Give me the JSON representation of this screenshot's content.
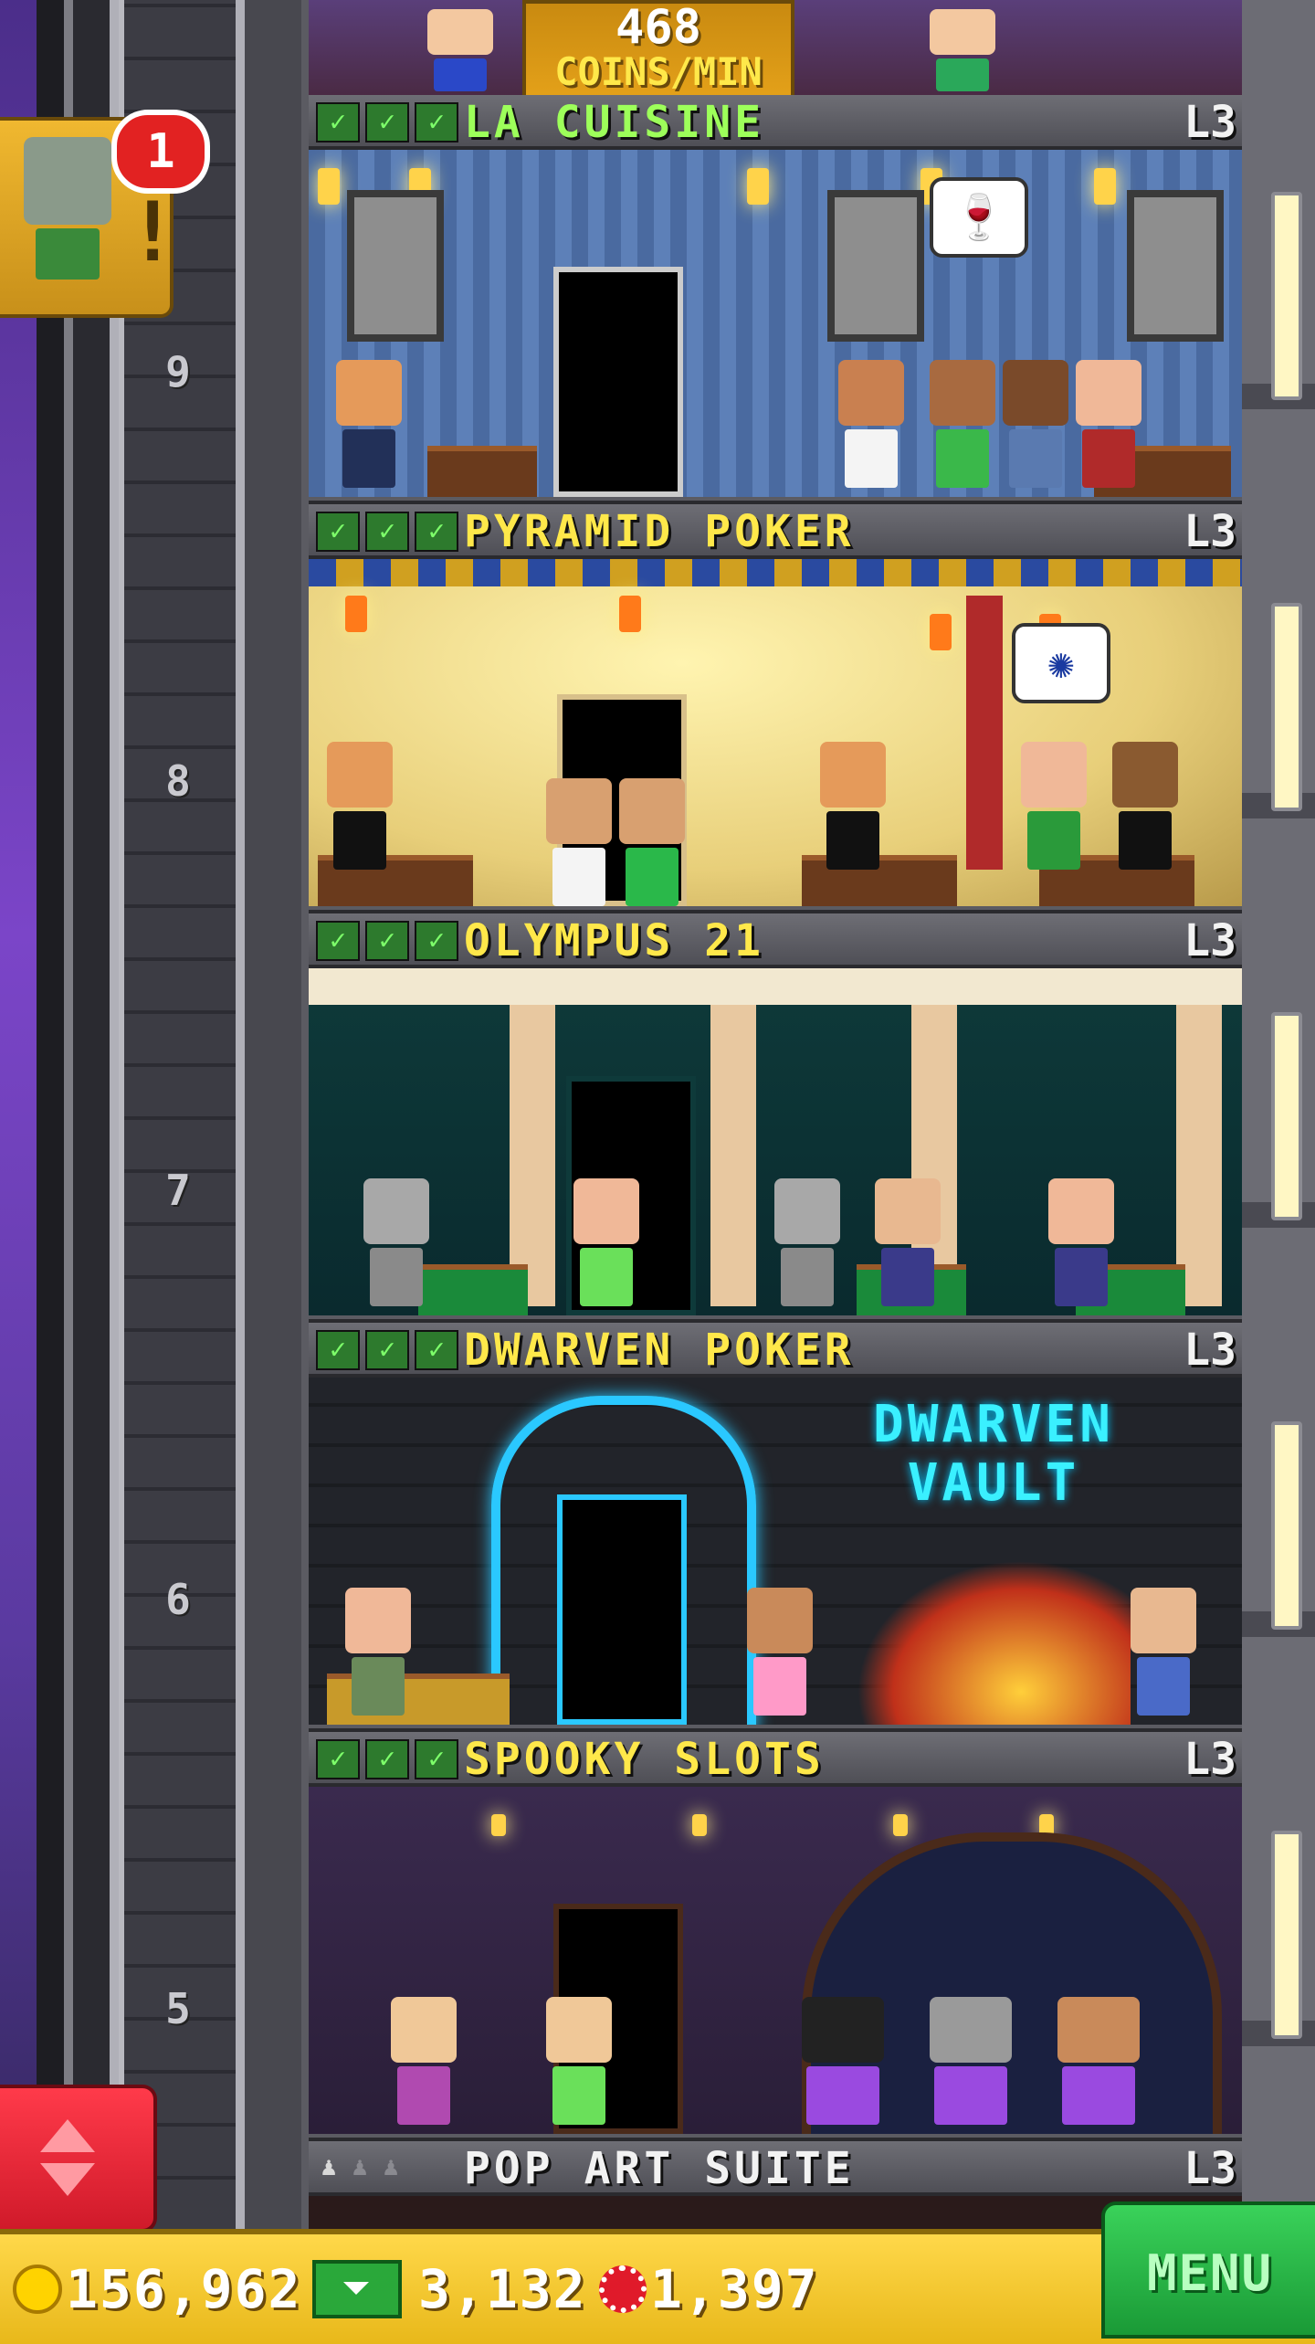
{
  "game": "tower-casino",
  "top_room": {
    "coins_per_min_value": "468",
    "coins_per_min_label": "COINS/MIN"
  },
  "notification": {
    "count": "1",
    "icon": "zombie-visitor-icon",
    "mark": "!"
  },
  "floors": [
    {
      "number": "9",
      "name": "LA CUISINE",
      "name_color": "#9dff5a",
      "level": "L3",
      "stocked": [
        "check",
        "check",
        "check"
      ],
      "theme": "restaurant",
      "bubble": "wine-glass-icon"
    },
    {
      "number": "8",
      "name": "PYRAMID POKER",
      "name_color": "#ffe84a",
      "level": "L3",
      "stocked": [
        "check",
        "check",
        "check"
      ],
      "theme": "egyptian",
      "bubble": "poker-chip-icon"
    },
    {
      "number": "7",
      "name": "OLYMPUS 21",
      "name_color": "#ffe84a",
      "level": "L3",
      "stocked": [
        "check",
        "check",
        "check"
      ],
      "theme": "greek"
    },
    {
      "number": "6",
      "name": "DWARVEN POKER",
      "name_color": "#ffe84a",
      "level": "L3",
      "stocked": [
        "check",
        "check",
        "check"
      ],
      "theme": "dwarven",
      "sign": "DWARVEN\nVAULT"
    },
    {
      "number": "5",
      "name": "SPOOKY SLOTS",
      "name_color": "#ffe84a",
      "level": "L3",
      "stocked": [
        "check",
        "check",
        "check"
      ],
      "theme": "spooky"
    },
    {
      "number": "",
      "name": "POP ART SUITE",
      "name_color": "#f2f2f2",
      "level": "L3",
      "residents": [
        "person",
        "empty",
        "empty"
      ],
      "theme": "suite"
    }
  ],
  "currency": {
    "coins": "156,962",
    "bux": "3,132",
    "chips": "1,397"
  },
  "menu_label": "MENU",
  "colors": {
    "gold_bar": "#e8b81a",
    "menu_green": "#1a9a36",
    "elevator_red": "#d01a2a",
    "check_green": "#2d7a2d"
  }
}
